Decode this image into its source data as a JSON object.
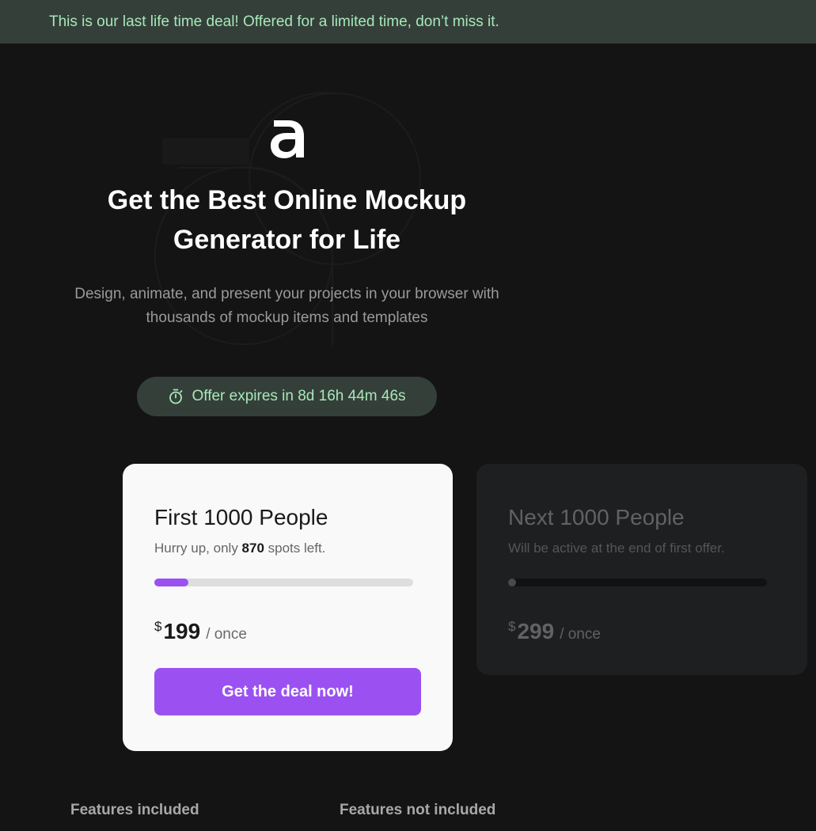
{
  "banner": {
    "text": "This is our last life time deal! Offered for a limited time, don’t miss it."
  },
  "hero": {
    "logo_icon": "app-logo-a",
    "title": "Get the Best Online Mockup Generator for Life",
    "subtitle": "Design, animate, and present your projects in your browser with thousands of mockup items and templates"
  },
  "timer": {
    "icon": "stopwatch-icon",
    "text": "Offer expires in 8d 16h 44m 46s"
  },
  "offers": [
    {
      "title": "First 1000 People",
      "note_prefix": "Hurry up, only ",
      "note_count": "870",
      "note_suffix": " spots left.",
      "progress": 0.13,
      "currency": "$",
      "price": "199",
      "period": "/ once",
      "cta": "Get the deal now!"
    },
    {
      "title": "Next 1000 People",
      "note": "Will be active at the end of first offer.",
      "progress": 0,
      "currency": "$",
      "price": "299",
      "period": "/ once"
    }
  ],
  "features": {
    "included_heading": "Features included",
    "not_included_heading": "Features not included"
  },
  "colors": {
    "background": "#141414",
    "banner_bg": "#353f3a",
    "banner_text": "#a6e8b8",
    "accent": "#9b51f2",
    "card_light": "#f9f9f9",
    "card_dark": "#1e1f21"
  }
}
